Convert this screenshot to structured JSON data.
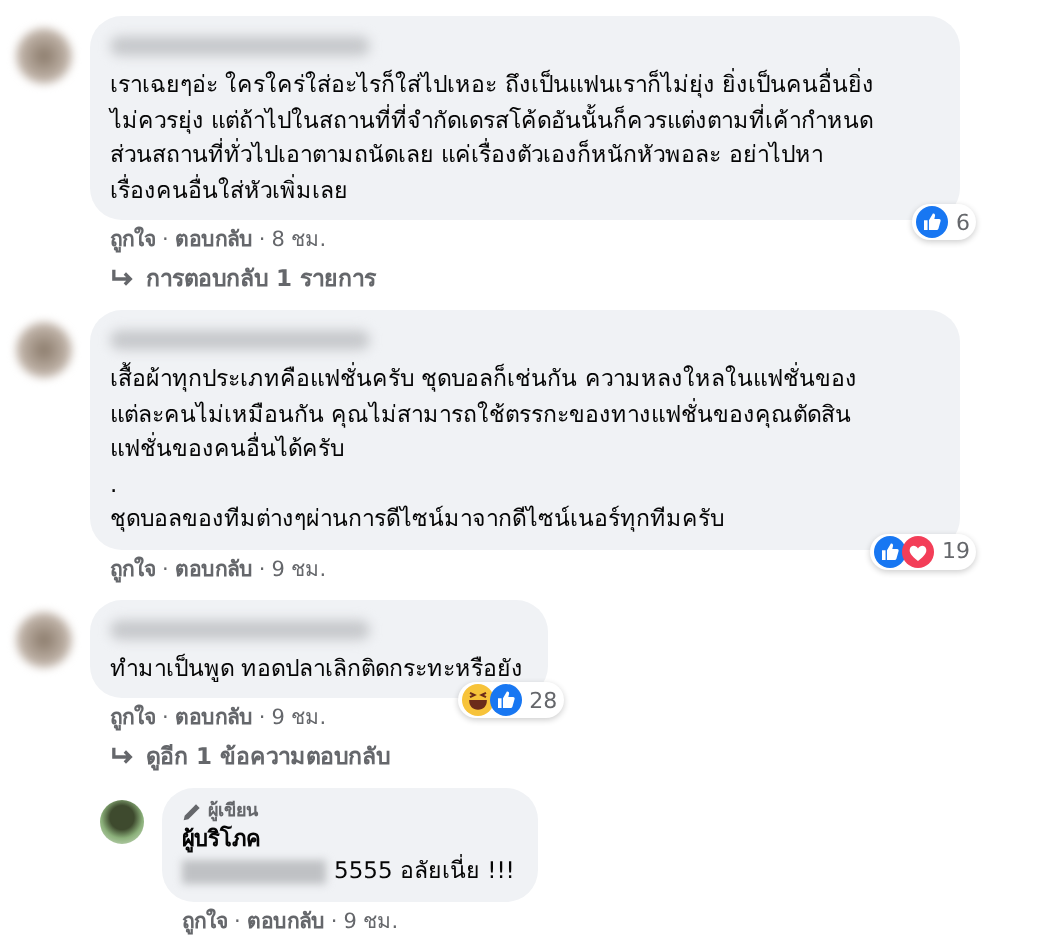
{
  "separator": "·",
  "comments": [
    {
      "author_blurred": true,
      "text_lines": [
        "เราเฉยๆอ่ะ ใครใคร่ใส่อะไรก็ใส่ไปเหอะ ถึงเป็นแฟนเราก็ไม่ยุ่ง ยิ่งเป็นคนอื่นยิ่ง",
        "ไม่ควรยุ่ง แต่ถ้าไปในสถานที่ที่จำกัดเดรสโค้ดอันนั้นก็ควรแต่งตามที่เค้ากำหนด",
        "ส่วนสถานที่ทั่วไปเอาตามถนัดเลย แค่เรื่องตัวเองก็หนักหัวพอละ อย่าไปหา",
        "เรื่องคนอื่นใส่หัวเพิ่มเลย"
      ],
      "reactions": {
        "haha": false,
        "like": true,
        "love": false
      },
      "reaction_count": "6",
      "actions": [
        "ถูกใจ",
        "ตอบกลับ"
      ],
      "time": "8 ชม.",
      "replies_link": "การตอบกลับ 1 รายการ"
    },
    {
      "author_blurred": true,
      "text_lines": [
        "เสื้อผ้าทุกประเภทคือแฟชั่นครับ ชุดบอลก็เช่นกัน ความหลงใหลในแฟชั่นของ",
        "แต่ละคนไม่เหมือนกัน คุณไม่สามารถใช้ตรรกะของทางแฟชั่นของคุณตัดสิน",
        "แฟชั่นของคนอื่นได้ครับ",
        ".",
        "ชุดบอลของทีมต่างๆผ่านการดีไซน์มาจากดีไซน์เนอร์ทุกทีมครับ"
      ],
      "reactions": {
        "haha": false,
        "like": true,
        "love": true
      },
      "reaction_count": "19",
      "actions": [
        "ถูกใจ",
        "ตอบกลับ"
      ],
      "time": "9 ชม."
    },
    {
      "author_blurred": true,
      "text_lines": [
        "ทำมาเป็นพูด ทอดปลาเลิกติดกระทะหรือยัง"
      ],
      "reactions": {
        "haha": true,
        "like": true,
        "love": false
      },
      "reaction_count": "28",
      "actions": [
        "ถูกใจ",
        "ตอบกลับ"
      ],
      "time": "9 ชม.",
      "replies_link": "ดูอีก 1 ข้อความตอบกลับ",
      "replies": [
        {
          "author_blurred": false,
          "author_badge": "ผู้เขียน",
          "author": "ผู้บริโภค",
          "blurred_prefix": true,
          "text_lines": [
            "5555 อลัยเนี่ย !!!"
          ],
          "actions": [
            "ถูกใจ",
            "ตอบกลับ"
          ],
          "time": "9 ชม."
        }
      ]
    }
  ]
}
